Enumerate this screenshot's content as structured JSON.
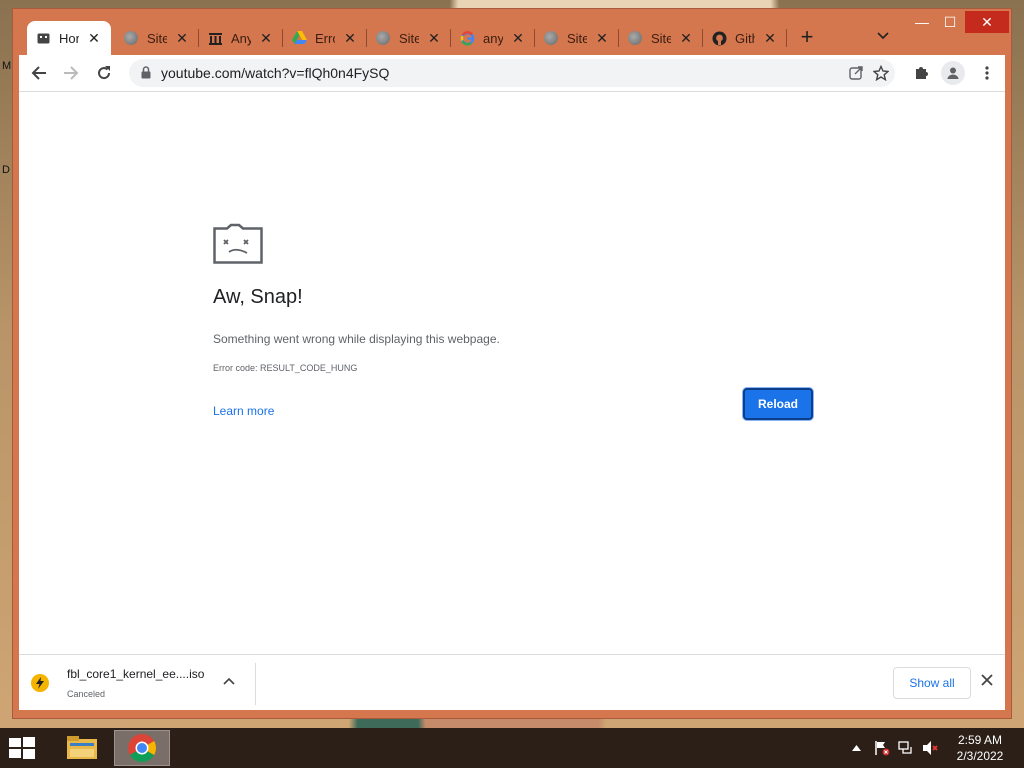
{
  "desktop": {
    "icon_label_top": "M",
    "icon_label_mid": "D"
  },
  "browser": {
    "tabs": [
      {
        "label": "Hor",
        "icon": "page-icon",
        "active": true
      },
      {
        "label": "Site",
        "icon": "globe-icon"
      },
      {
        "label": "Any",
        "icon": "archive-icon"
      },
      {
        "label": "Erro",
        "icon": "google-drive-icon"
      },
      {
        "label": "Site",
        "icon": "globe-icon"
      },
      {
        "label": "any",
        "icon": "google-icon"
      },
      {
        "label": "Site",
        "icon": "globe-icon"
      },
      {
        "label": "Site",
        "icon": "globe-icon"
      },
      {
        "label": "Gith",
        "icon": "github-icon"
      }
    ],
    "tab_close_glyph": "✕",
    "new_tab_glyph": "+",
    "window_controls": {
      "minimize": "—",
      "maximize": "☐",
      "close": "✕"
    },
    "url": "youtube.com/watch?v=flQh0n4FySQ"
  },
  "error_page": {
    "title": "Aw, Snap!",
    "description": "Something went wrong while displaying this webpage.",
    "error_code": "Error code: RESULT_CODE_HUNG",
    "learn_more": "Learn more",
    "reload": "Reload"
  },
  "downloads": {
    "filename": "fbl_core1_kernel_ee....iso",
    "status": "Canceled",
    "show_all": "Show all"
  },
  "taskbar": {
    "time": "2:59 AM",
    "date": "2/3/2022"
  },
  "colors": {
    "frame": "#d4774e",
    "accent": "#1a73e8"
  }
}
